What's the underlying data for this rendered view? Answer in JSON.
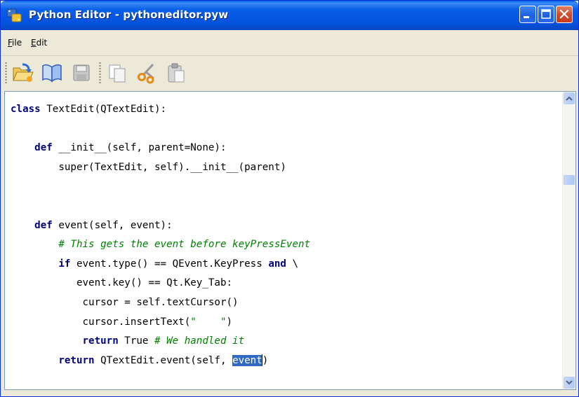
{
  "window": {
    "title": "Python Editor - pythoneditor.pyw",
    "colors": {
      "title_bar": "#0a5fe8",
      "close_button": "#d4482a",
      "selection": "#316ac5",
      "keyword": "#000080",
      "comment": "#008000"
    }
  },
  "title_buttons": [
    "minimize-icon",
    "maximize-icon",
    "close-icon"
  ],
  "menu": {
    "items": [
      {
        "accel": "F",
        "rest": "ile"
      },
      {
        "accel": "E",
        "rest": "dit"
      }
    ]
  },
  "toolbar": {
    "tools": [
      "open-icon",
      "book-icon",
      "save-icon",
      "copy-icon",
      "cut-icon",
      "paste-icon"
    ]
  },
  "editor": {
    "lines": [
      {
        "segments": [
          {
            "t": "kw",
            "v": "class"
          },
          {
            "t": "tx",
            "v": " TextEdit(QTextEdit):"
          }
        ]
      },
      {
        "segments": []
      },
      {
        "segments": [
          {
            "t": "tx",
            "v": "    "
          },
          {
            "t": "kw",
            "v": "def"
          },
          {
            "t": "tx",
            "v": " __init__(self, parent=None):"
          }
        ]
      },
      {
        "segments": [
          {
            "t": "tx",
            "v": "        super(TextEdit, self).__init__(parent)"
          }
        ]
      },
      {
        "segments": []
      },
      {
        "segments": []
      },
      {
        "segments": [
          {
            "t": "tx",
            "v": "    "
          },
          {
            "t": "kw",
            "v": "def"
          },
          {
            "t": "tx",
            "v": " event(self, event):"
          }
        ]
      },
      {
        "segments": [
          {
            "t": "tx",
            "v": "        "
          },
          {
            "t": "cm",
            "v": "# This gets the event before keyPressEvent"
          }
        ]
      },
      {
        "segments": [
          {
            "t": "tx",
            "v": "        "
          },
          {
            "t": "kw",
            "v": "if"
          },
          {
            "t": "tx",
            "v": " event.type() == QEvent.KeyPress "
          },
          {
            "t": "kw",
            "v": "and"
          },
          {
            "t": "tx",
            "v": " \\"
          }
        ]
      },
      {
        "segments": [
          {
            "t": "tx",
            "v": "           event.key() == Qt.Key_Tab:"
          }
        ]
      },
      {
        "segments": [
          {
            "t": "tx",
            "v": "            cursor = self.textCursor()"
          }
        ]
      },
      {
        "segments": [
          {
            "t": "tx",
            "v": "            cursor.insertText("
          },
          {
            "t": "st",
            "v": "\"    \""
          },
          {
            "t": "tx",
            "v": ")"
          }
        ]
      },
      {
        "segments": [
          {
            "t": "tx",
            "v": "            "
          },
          {
            "t": "kw",
            "v": "return"
          },
          {
            "t": "tx",
            "v": " True "
          },
          {
            "t": "cm",
            "v": "# We handled it"
          }
        ]
      },
      {
        "segments": [
          {
            "t": "tx",
            "v": "        "
          },
          {
            "t": "kw",
            "v": "return"
          },
          {
            "t": "tx",
            "v": " QTextEdit.event(self, "
          },
          {
            "t": "sel",
            "v": "event"
          },
          {
            "t": "tx",
            "v": ")"
          }
        ]
      }
    ]
  }
}
